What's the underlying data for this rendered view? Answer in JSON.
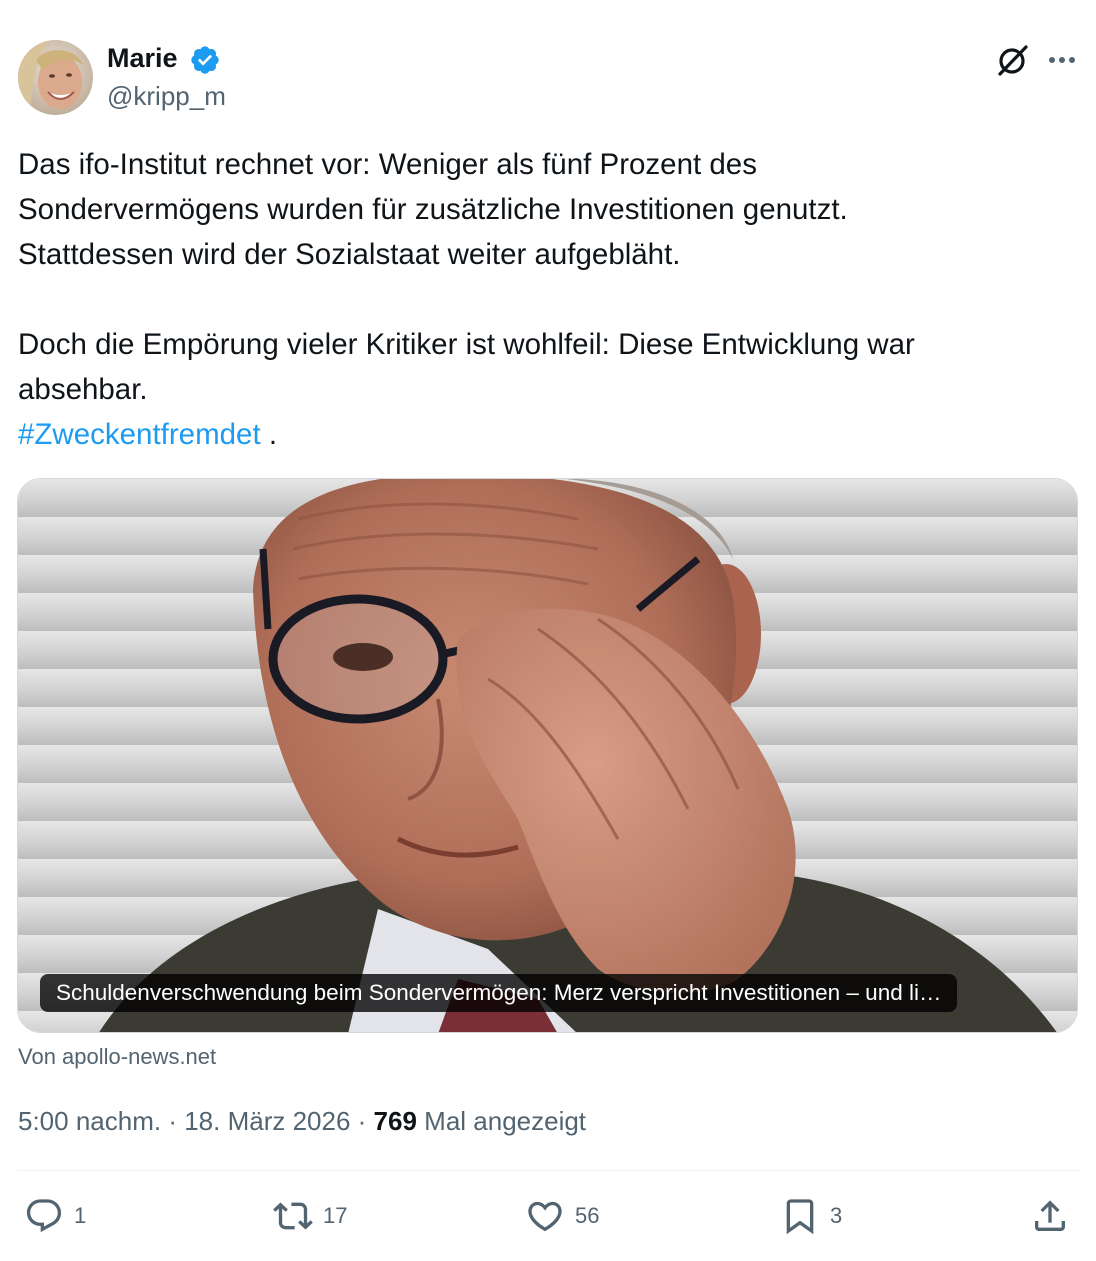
{
  "author": {
    "name": "Marie",
    "handle": "@kripp_m",
    "verified": true
  },
  "icons": {
    "verified": "verified-badge-icon",
    "grok": "grok-icon",
    "more": "more-options-icon",
    "reply": "reply-icon",
    "retweet": "retweet-icon",
    "like": "heart-icon",
    "bookmark": "bookmark-icon",
    "share": "share-icon"
  },
  "tweet": {
    "lines_para1": [
      "Das ifo-Institut rechnet vor: Weniger als fünf Prozent des",
      "Sondervermögens wurden für zusätzliche Investitionen genutzt.",
      "Stattdessen wird der Sozialstaat weiter aufgebläht."
    ],
    "lines_para2": [
      "Doch die Empörung vieler Kritiker ist wohlfeil: Diese Entwicklung war",
      "absehbar."
    ],
    "hashtag": "#Zweckentfremdet",
    "hashtag_suffix": " ."
  },
  "card": {
    "caption": "Schuldenverschwendung beim Sondervermögen: Merz verspricht Investitionen – und li…",
    "source": "Von apollo-news.net"
  },
  "meta": {
    "time": "5:00 nachm.",
    "separator": " · ",
    "date": "18. März 2026",
    "views_count": "769",
    "views_label": "Mal angezeigt"
  },
  "actions": {
    "replies": "1",
    "retweets": "17",
    "likes": "56",
    "bookmarks": "3"
  },
  "colors": {
    "accent": "#1d9bf0",
    "text": "#0f1419",
    "secondary": "#536471"
  }
}
